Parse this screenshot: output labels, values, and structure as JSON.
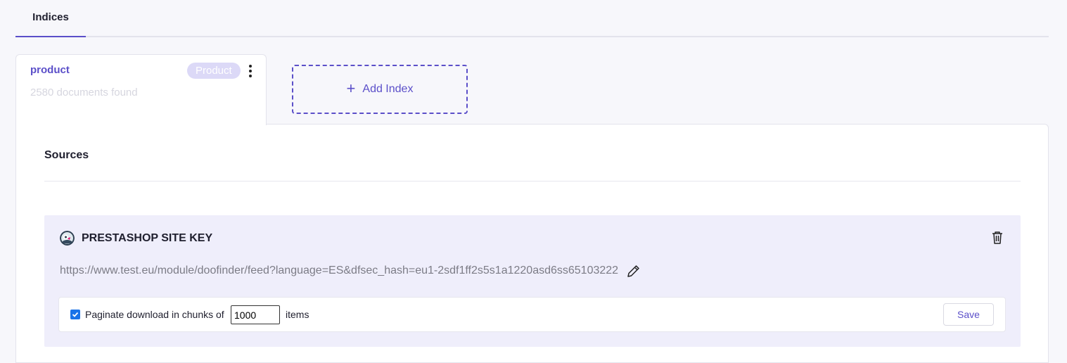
{
  "tabs": {
    "active_label": "Indices"
  },
  "index_card": {
    "name": "product",
    "badge": "Product",
    "count_text": "2580 documents found"
  },
  "add_index": {
    "label": "Add Index"
  },
  "sources": {
    "title": "Sources",
    "source": {
      "icon": "prestashop-logo",
      "title": "PRESTASHOP SITE KEY",
      "url": "https://www.test.eu/module/doofinder/feed?language=ES&dfsec_hash=eu1-2sdf1ff2s5s1a1220asd6ss65103222",
      "paginate": {
        "checked": true,
        "label": "Paginate download in chunks of",
        "value": "1000",
        "suffix": "items"
      },
      "save_label": "Save"
    }
  },
  "colors": {
    "accent": "#5b4fc9",
    "badge_bg": "#dcd9f7",
    "source_bg": "#efeefb",
    "checkbox": "#1a73e8"
  }
}
